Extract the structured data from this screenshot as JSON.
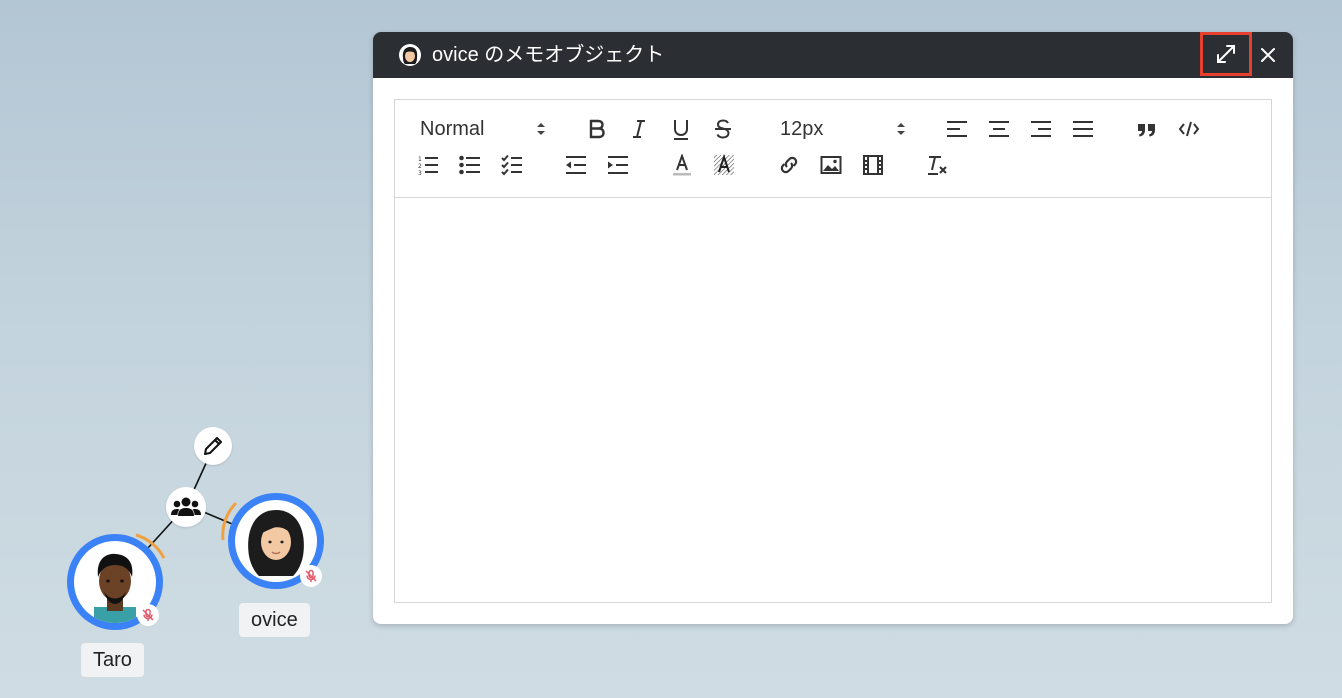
{
  "memo": {
    "title": "ovice のメモオブジェクト",
    "expand_icon": "expand-diagonal-icon",
    "close_icon": "close-icon",
    "accent_highlight": "#e8402e",
    "titlebar_color": "#2b2e32"
  },
  "toolbar": {
    "heading_select": {
      "value": "Normal",
      "options_icon": "up-down-arrows-icon"
    },
    "size_select": {
      "value": "12px",
      "options_icon": "up-down-arrows-icon"
    },
    "buttons_row1": [
      "bold-icon",
      "italic-icon",
      "underline-icon",
      "strikethrough-icon",
      "align-left-icon",
      "align-center-icon",
      "align-right-icon",
      "align-justify-icon",
      "blockquote-icon",
      "code-icon"
    ],
    "buttons_row2": [
      "ordered-list-icon",
      "bullet-list-icon",
      "check-list-icon",
      "outdent-icon",
      "indent-icon",
      "text-color-icon",
      "background-color-icon",
      "link-icon",
      "image-icon",
      "video-icon",
      "clear-format-icon"
    ]
  },
  "editor": {
    "content": ""
  },
  "canvas": {
    "users": [
      {
        "name": "Taro",
        "mic_icon": "mic-muted-icon"
      },
      {
        "name": "ovice",
        "mic_icon": "mic-muted-icon"
      }
    ],
    "group_icon": "group-users-icon",
    "edit_icon": "pencil-icon",
    "ring_color": "#3b82f6",
    "speaking_arc_color": "#f0a040"
  }
}
